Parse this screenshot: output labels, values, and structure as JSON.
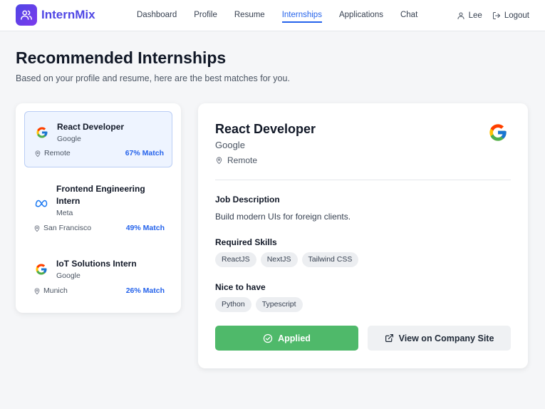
{
  "header": {
    "logo_text": "InternMix",
    "nav": [
      {
        "label": "Dashboard",
        "active": false
      },
      {
        "label": "Profile",
        "active": false
      },
      {
        "label": "Resume",
        "active": false
      },
      {
        "label": "Internships",
        "active": true
      },
      {
        "label": "Applications",
        "active": false
      },
      {
        "label": "Chat",
        "active": false
      }
    ],
    "user_name": "Lee",
    "logout_label": "Logout"
  },
  "page": {
    "title": "Recommended Internships",
    "subtitle": "Based on your profile and resume, here are the best matches for you."
  },
  "internships": [
    {
      "title": "React Developer",
      "company": "Google",
      "location": "Remote",
      "match": "67% Match",
      "icon": "google-logo-icon",
      "selected": true
    },
    {
      "title": "Frontend Engineering Intern",
      "company": "Meta",
      "location": "San Francisco",
      "match": "49% Match",
      "icon": "meta-logo-icon",
      "selected": false
    },
    {
      "title": "IoT Solutions Intern",
      "company": "Google",
      "location": "Munich",
      "match": "26% Match",
      "icon": "google-logo-icon",
      "selected": false
    }
  ],
  "detail": {
    "title": "React Developer",
    "company": "Google",
    "location": "Remote",
    "description_heading": "Job Description",
    "description": "Build modern UIs for foreign clients.",
    "skills_heading": "Required Skills",
    "skills": [
      "ReactJS",
      "NextJS",
      "Tailwind CSS"
    ],
    "nice_heading": "Nice to have",
    "nice": [
      "Python",
      "Typescript"
    ],
    "applied_label": "Applied",
    "site_label": "View on Company Site"
  },
  "colors": {
    "brand": "#4f46e5",
    "accent": "#2563eb",
    "applied_green": "#4fb96a"
  }
}
